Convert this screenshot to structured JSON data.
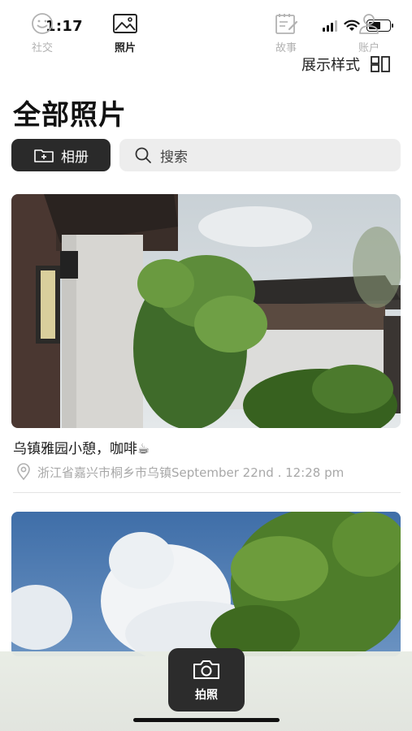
{
  "status": {
    "time": "1:17"
  },
  "header": {
    "display_style": "展示样式",
    "title": "全部照片"
  },
  "toolbar": {
    "album_label": "相册",
    "search_placeholder": "搜索"
  },
  "posts": [
    {
      "caption": "乌镇雅园小憩，咖啡☕",
      "location": "浙江省嘉兴市桐乡市乌镇September 22nd . 12:28 pm"
    }
  ],
  "tabs": {
    "social": "社交",
    "photos": "照片",
    "camera": "拍照",
    "stories": "故事",
    "account": "账户"
  },
  "colors": {
    "dark": "#2a2a2a",
    "muted": "#b2b2b2",
    "search_bg": "#ededed"
  }
}
